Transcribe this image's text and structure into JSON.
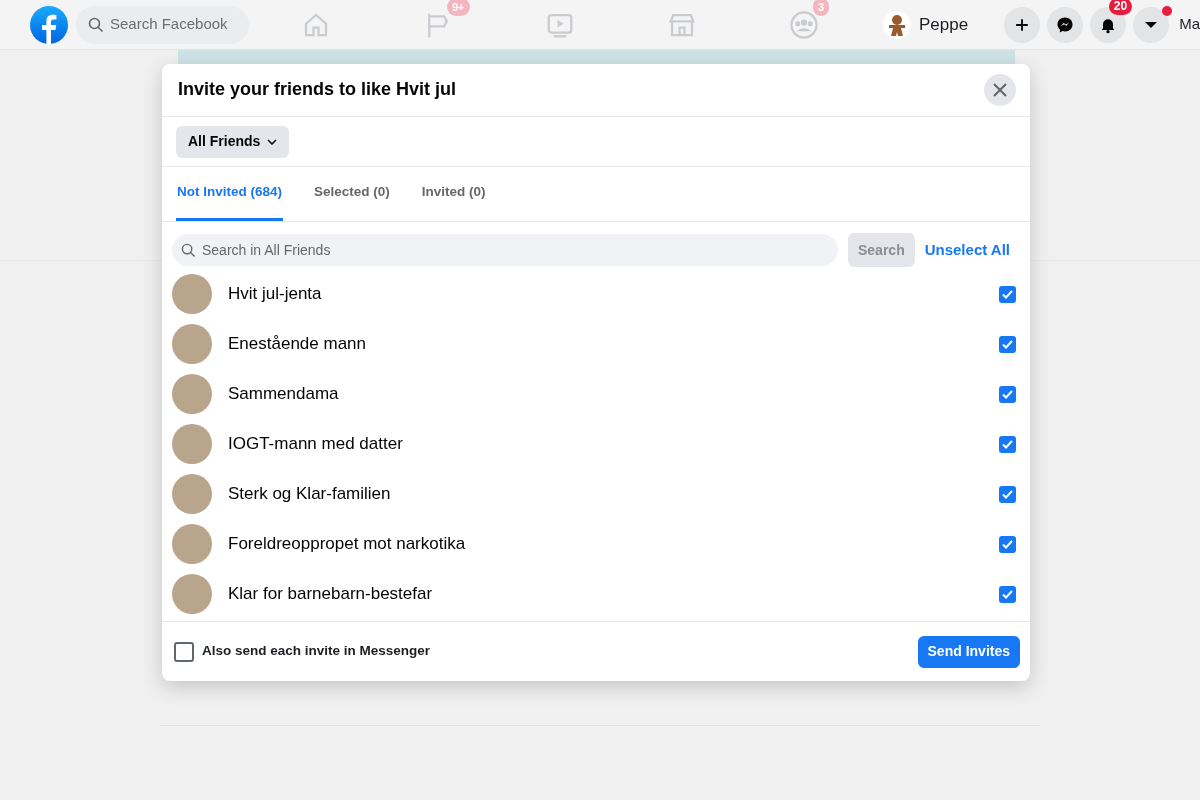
{
  "navbar": {
    "search_placeholder": "Search Facebook",
    "nav_icons": [
      {
        "kind": "home"
      },
      {
        "kind": "flag",
        "badge": "9+"
      },
      {
        "kind": "video"
      },
      {
        "kind": "store"
      },
      {
        "kind": "groups",
        "badge": "3"
      }
    ],
    "profile_name": "Peppe",
    "action_buttons": [
      {
        "kind": "plus",
        "dot": false
      },
      {
        "kind": "messenger",
        "dot": false
      },
      {
        "kind": "bell",
        "badge": "20",
        "dot": false
      },
      {
        "kind": "caret",
        "dot": true
      }
    ],
    "cut_text": "Ma"
  },
  "dialog": {
    "title": "Invite your friends to like Hvit jul",
    "filter": "All Friends",
    "tabs": [
      {
        "label": "Not Invited (684)",
        "selected": true
      },
      {
        "label": "Selected (0)",
        "selected": false
      },
      {
        "label": "Invited (0)",
        "selected": false
      }
    ],
    "search_placeholder": "Search in All Friends",
    "search_button": "Search",
    "unselect_all": "Unselect All",
    "friends": [
      {
        "name": "Hvit jul-jenta",
        "checked": true
      },
      {
        "name": "Enestående mann",
        "checked": true
      },
      {
        "name": "Sammendama",
        "checked": true
      },
      {
        "name": "IOGT-mann med datter",
        "checked": true
      },
      {
        "name": "Sterk og Klar-familien",
        "checked": true
      },
      {
        "name": "Foreldreoppropet mot narkotika",
        "checked": true
      },
      {
        "name": "Klar for barnebarn-bestefar",
        "checked": true
      }
    ],
    "messenger_option": {
      "label": "Also send each invite in Messenger",
      "checked": false
    },
    "send_button": "Send Invites"
  }
}
